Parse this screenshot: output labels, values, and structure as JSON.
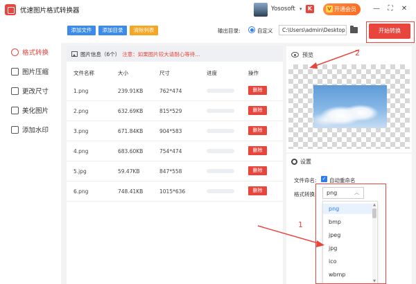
{
  "window": {
    "title": "优速图片格式转换器",
    "user_name": "Yososoft",
    "user_badge": "K",
    "vip_label": "开通会员",
    "vip_icon": "V",
    "chev_glyph": "▾",
    "min_glyph": "—",
    "max_glyph": "⛶",
    "close_glyph": "✕"
  },
  "sidebar": {
    "items": [
      {
        "label": "格式转换",
        "icon": "convert-icon",
        "active": true
      },
      {
        "label": "图片压缩",
        "icon": "compress-icon",
        "active": false
      },
      {
        "label": "更改尺寸",
        "icon": "resize-icon",
        "active": false
      },
      {
        "label": "美化图片",
        "icon": "beautify-icon",
        "active": false
      },
      {
        "label": "添加水印",
        "icon": "watermark-icon",
        "active": false
      }
    ]
  },
  "toolbar": {
    "add_file": "添加文件",
    "add_folder": "添加目录",
    "clear_list": "清除列表",
    "output_label": "输出目录:",
    "custom_label": "自定义",
    "output_path": "C:\\Users\\admin\\Desktop",
    "start_label": "开始转换"
  },
  "file_list": {
    "info": "图片信息（6个）",
    "warning": "注意：如果图片较大请耐心等待...",
    "columns": {
      "name": "文件名称",
      "size": "大小",
      "dims": "尺寸",
      "progress": "进度",
      "action": "操作"
    },
    "delete_label": "删除",
    "rows": [
      {
        "name": "1.png",
        "size": "239.91KB",
        "dims": "762*474",
        "progress": 0
      },
      {
        "name": "2.png",
        "size": "632.69KB",
        "dims": "815*529",
        "progress": 0
      },
      {
        "name": "3.png",
        "size": "671.84KB",
        "dims": "904*583",
        "progress": 0
      },
      {
        "name": "4.png",
        "size": "683.60KB",
        "dims": "754*474",
        "progress": 0
      },
      {
        "name": "5.jpg",
        "size": "59.47KB",
        "dims": "847*558",
        "progress": 0
      },
      {
        "name": "6.png",
        "size": "748.41KB",
        "dims": "1015*636",
        "progress": 0
      }
    ]
  },
  "preview": {
    "title": "预览"
  },
  "settings": {
    "title": "设置",
    "naming_label": "文件命名:",
    "auto_rename": "自动重命名",
    "auto_rename_checked": true,
    "format_label": "格式转换:",
    "format_value": "png",
    "format_options": [
      "png",
      "bmp",
      "jpeg",
      "jpg",
      "ico",
      "wbmp"
    ],
    "select_chev": "︿",
    "check_glyph": "✓",
    "scroll_up": "▲",
    "scroll_down": "▼"
  },
  "annotations": {
    "step1": "1",
    "step2": "2",
    "color": "#e8453c"
  },
  "colors": {
    "accent_red": "#e8453c",
    "accent_blue": "#2d7cf6",
    "add_btn_blue": "#3b8bea",
    "clear_btn_orange": "#f5a623"
  }
}
